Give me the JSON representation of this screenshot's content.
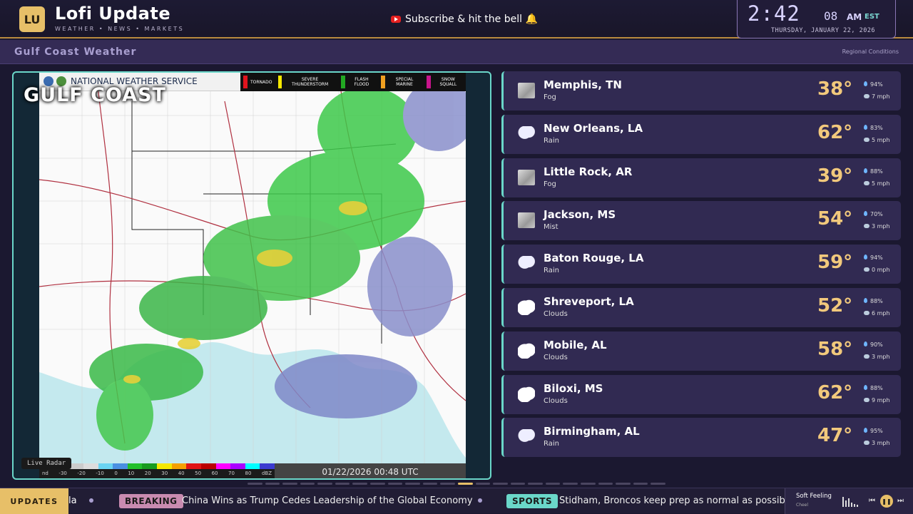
{
  "header": {
    "logo_text": "LU",
    "title": "Lofi Update",
    "subtitle": "WEATHER • NEWS • MARKETS",
    "subscribe_text": "Subscribe & hit the bell 🔔",
    "clock_time": "2:42",
    "clock_seconds": "08",
    "clock_ampm": "AM",
    "clock_tz": "EST",
    "clock_date": "THURSDAY, JANUARY 22, 2026"
  },
  "section": {
    "title": "Gulf Coast Weather",
    "right_label": "Regional Conditions"
  },
  "radar": {
    "provider": "NATIONAL WEATHER SERVICE",
    "area_label": "GULF COAST",
    "timestamp": "01/22/2026 00:48 UTC",
    "live_label": "Live Radar",
    "legend": [
      {
        "label": "TORNADO",
        "color": "#e0141e"
      },
      {
        "label": "SEVERE THUNDERSTORM",
        "color": "#f5e800"
      },
      {
        "label": "FLASH FLOOD",
        "color": "#22a822"
      },
      {
        "label": "SPECIAL MARINE",
        "color": "#f0a020"
      },
      {
        "label": "SNOW SQUALL",
        "color": "#c8158c"
      }
    ],
    "scale_labels": [
      "nd",
      "-30",
      "-20",
      "-10",
      "0",
      "10",
      "20",
      "30",
      "40",
      "50",
      "60",
      "70",
      "80",
      "dBZ"
    ]
  },
  "cities": [
    {
      "name": "Memphis, TN",
      "condition": "Fog",
      "temp": "38°",
      "humidity": "94%",
      "wind": "7 mph",
      "icon": "fog-icon"
    },
    {
      "name": "New Orleans, LA",
      "condition": "Rain",
      "temp": "62°",
      "humidity": "83%",
      "wind": "5 mph",
      "icon": "rain-icon"
    },
    {
      "name": "Little Rock, AR",
      "condition": "Fog",
      "temp": "39°",
      "humidity": "88%",
      "wind": "5 mph",
      "icon": "fog-icon"
    },
    {
      "name": "Jackson, MS",
      "condition": "Mist",
      "temp": "54°",
      "humidity": "70%",
      "wind": "3 mph",
      "icon": "fog-icon"
    },
    {
      "name": "Baton Rouge, LA",
      "condition": "Rain",
      "temp": "59°",
      "humidity": "94%",
      "wind": "0 mph",
      "icon": "rain-icon"
    },
    {
      "name": "Shreveport, LA",
      "condition": "Clouds",
      "temp": "52°",
      "humidity": "88%",
      "wind": "6 mph",
      "icon": "cloud-icon"
    },
    {
      "name": "Mobile, AL",
      "condition": "Clouds",
      "temp": "58°",
      "humidity": "90%",
      "wind": "3 mph",
      "icon": "cloud-icon"
    },
    {
      "name": "Biloxi, MS",
      "condition": "Clouds",
      "temp": "62°",
      "humidity": "88%",
      "wind": "9 mph",
      "icon": "cloud-icon"
    },
    {
      "name": "Birmingham, AL",
      "condition": "Rain",
      "temp": "47°",
      "humidity": "95%",
      "wind": "3 mph",
      "icon": "rain-icon"
    }
  ],
  "ticker": {
    "updates_label": "UPDATES",
    "fragment": "la",
    "items": [
      {
        "tag": "BREAKING",
        "headline": "China Wins as Trump Cedes Leadership of the Global Economy"
      },
      {
        "tag": "SPORTS",
        "headline": "Stidham, Broncos keep prep as normal as possible"
      }
    ]
  },
  "player": {
    "song": "Soft Feeling",
    "artist": "Cheel"
  }
}
